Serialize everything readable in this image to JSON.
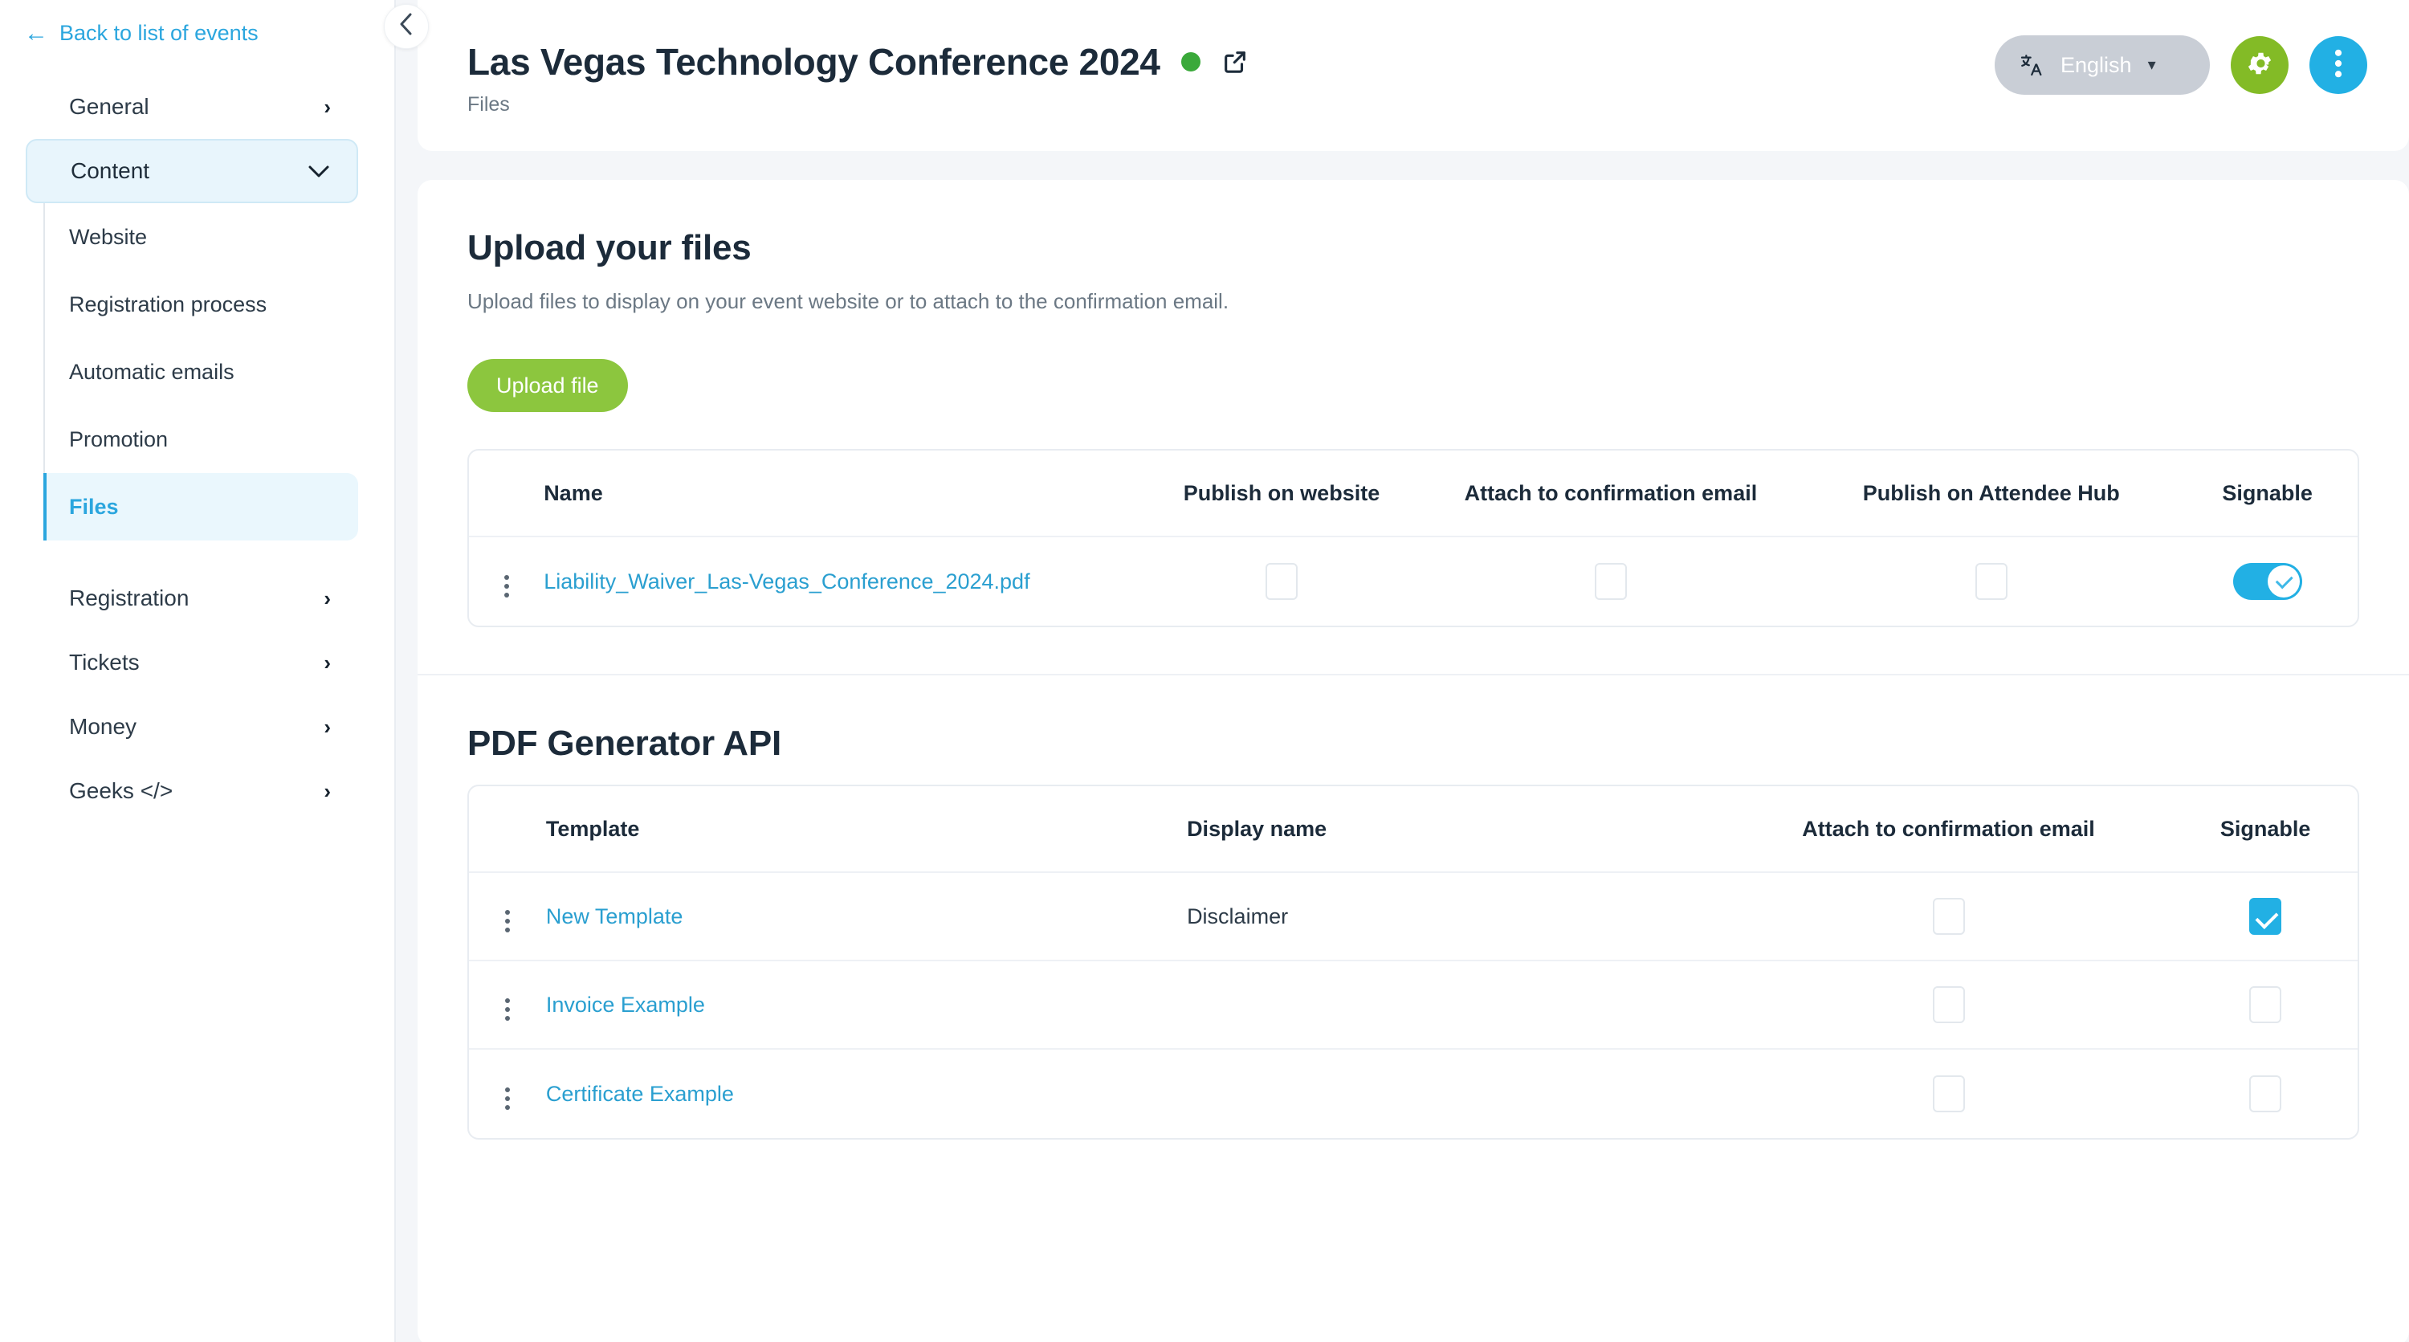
{
  "sidebar": {
    "back_label": "Back to list of events",
    "back_icon": "arrow-left-icon",
    "items": [
      {
        "label": "General",
        "chevron": "›"
      },
      {
        "label": "Content",
        "chevron": "⌄"
      },
      {
        "label": "Registration",
        "chevron": "›"
      },
      {
        "label": "Tickets",
        "chevron": "›"
      },
      {
        "label": "Money",
        "chevron": "›"
      },
      {
        "label": "Geeks </>",
        "chevron": "›"
      }
    ],
    "subitems": [
      {
        "label": "Website"
      },
      {
        "label": "Registration process"
      },
      {
        "label": "Automatic emails"
      },
      {
        "label": "Promotion"
      },
      {
        "label": "Files"
      }
    ],
    "active_item": "Content",
    "active_subitem": "Files",
    "collapse_icon": "chevron-left-icon"
  },
  "header": {
    "title": "Las Vegas Technology Conference 2024",
    "status_color": "#3aa93a",
    "breadcrumb": "Files",
    "external_link_icon": "external-link-icon",
    "language": "English",
    "language_icon": "translate-icon",
    "language_caret": "▾",
    "settings_icon": "gear-icon",
    "more_icon": "kebab-menu-icon",
    "accent_green": "#83bb26",
    "accent_blue": "#22b0e4"
  },
  "upload_section": {
    "title": "Upload your files",
    "subtitle": "Upload files to display on your event website or to attach to the confirmation email.",
    "button_label": "Upload file",
    "table": {
      "columns": [
        "Name",
        "Publish on website",
        "Attach to confirmation email",
        "Publish on Attendee Hub",
        "Signable"
      ],
      "rows": [
        {
          "name": "Liability_Waiver_Las-Vegas_Conference_2024.pdf",
          "publish_on_website": false,
          "attach_to_confirmation_email": false,
          "publish_on_attendee_hub": false,
          "signable": true
        }
      ]
    }
  },
  "pdf_section": {
    "title": "PDF Generator API",
    "table": {
      "columns": [
        "Template",
        "Display name",
        "Attach to confirmation email",
        "Signable"
      ],
      "rows": [
        {
          "template": "New Template",
          "display_name": "Disclaimer",
          "attach_to_confirmation_email": false,
          "signable": true
        },
        {
          "template": "Invoice Example",
          "display_name": "",
          "attach_to_confirmation_email": false,
          "signable": false
        },
        {
          "template": "Certificate Example",
          "display_name": "",
          "attach_to_confirmation_email": false,
          "signable": false
        }
      ]
    }
  }
}
